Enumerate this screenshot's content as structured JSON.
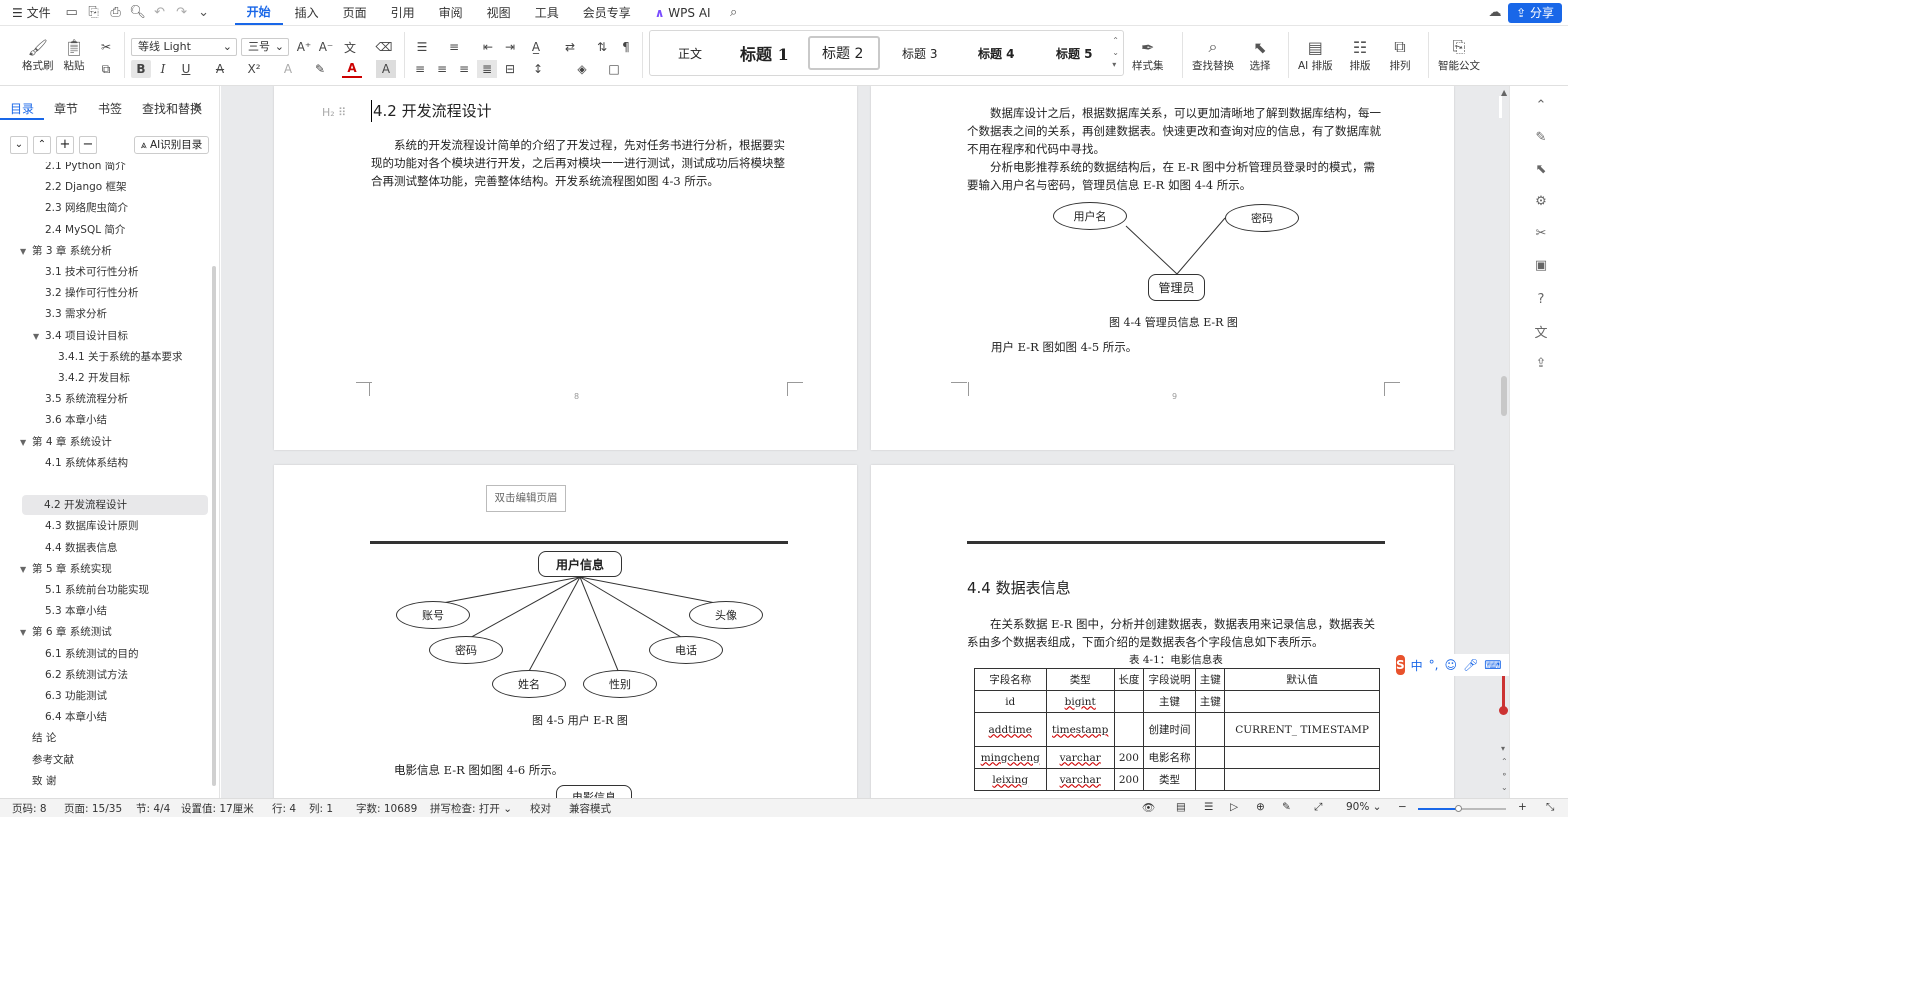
{
  "topbar": {
    "file": "文件",
    "tabs": [
      "开始",
      "插入",
      "页面",
      "引用",
      "审阅",
      "视图",
      "工具",
      "会员专享"
    ],
    "wps_ai": "WPS AI",
    "share": "分享"
  },
  "ribbon": {
    "format_painter": "格式刷",
    "paste": "粘贴",
    "font_name": "等线 Light",
    "font_size": "三号",
    "styles": [
      "正文",
      "标题 1",
      "标题 2",
      "标题 3",
      "标题 4",
      "标题 5"
    ],
    "style_set": "样式集",
    "find_replace": "查找替换",
    "select": "选择",
    "ai_layout": "AI 排版",
    "layout": "排版",
    "arrange": "排列",
    "smart_doc": "智能公文"
  },
  "left": {
    "tabs": [
      "目录",
      "章节",
      "书签",
      "查找和替换"
    ],
    "ai_toc": "AI识别目录",
    "toc": [
      {
        "label": "2.1  Python 简介",
        "level": 2
      },
      {
        "label": "2.2  Django 框架",
        "level": 2
      },
      {
        "label": "2.3 网络爬虫简介",
        "level": 2
      },
      {
        "label": "2.4 MySQL 简介",
        "level": 2
      },
      {
        "label": "第 3 章   系统分析",
        "level": 1
      },
      {
        "label": "3.1   技术可行性分析",
        "level": 2
      },
      {
        "label": "3.2   操作可行性分析",
        "level": 2
      },
      {
        "label": "3.3   需求分析",
        "level": 2
      },
      {
        "label": "3.4   项目设计目标",
        "level": 2
      },
      {
        "label": "3.4.1 关于系统的基本要求",
        "level": 3
      },
      {
        "label": "3.4.2 开发目标",
        "level": 3
      },
      {
        "label": "3.5   系统流程分析",
        "level": 2
      },
      {
        "label": "3.6   本章小结",
        "level": 2
      },
      {
        "label": "第 4 章   系统设计",
        "level": 1
      },
      {
        "label": "4.1   系统体系结构",
        "level": 2
      },
      {
        "label": "",
        "level": 2
      },
      {
        "label": "4.2   开发流程设计",
        "level": 2
      },
      {
        "label": "4.3   数据库设计原则",
        "level": 2
      },
      {
        "label": "4.4   数据表信息",
        "level": 2
      },
      {
        "label": "第 5 章   系统实现",
        "level": 1
      },
      {
        "label": "5.1 系统前台功能实现",
        "level": 2
      },
      {
        "label": "5.3   本章小结",
        "level": 2
      },
      {
        "label": "第 6 章   系统测试",
        "level": 1
      },
      {
        "label": "6.1   系统测试的目的",
        "level": 2
      },
      {
        "label": "6.2   系统测试方法",
        "level": 2
      },
      {
        "label": "6.3   功能测试",
        "level": 2
      },
      {
        "label": "6.4   本章小结",
        "level": 2
      },
      {
        "label": "结   论",
        "level": 1
      },
      {
        "label": "参考文献",
        "level": 1
      },
      {
        "label": "致   谢",
        "level": 1
      }
    ]
  },
  "page8": {
    "heading": "4.2   开发流程设计",
    "para": "系统的开发流程设计简单的介绍了开发过程，先对任务书进行分析，根据要实现的功能对各个模块进行开发，之后再对模块一一进行测试，测试成功后将模块整合再测试整体功能，完善整体结构。开发系统流程图如图 4-3 所示。",
    "pageno": "8"
  },
  "page9": {
    "para1": "数据库设计之后，根据数据库关系，可以更加清晰地了解到数据库结构，每一个数据表之间的关系，再创建数据表。快速更改和查询对应的信息，有了数据库就不用在程序和代码中寻找。",
    "para2": "分析电影推荐系统的数据结构后，在 E-R 图中分析管理员登录时的模式，需要输入用户名与密码，管理员信息 E-R 如图 4-4 所示。",
    "er_nodes": {
      "user": "用户名",
      "pwd": "密码",
      "admin": "管理员"
    },
    "caption": "图 4-4  管理员信息 E-R 图",
    "para3": "用户 E-R 图如图 4-5 所示。",
    "pageno": "9"
  },
  "page10": {
    "header_hint": "双击编辑页眉",
    "center": "用户信息",
    "nodes": [
      "账号",
      "密码",
      "姓名",
      "性别",
      "电话",
      "头像"
    ],
    "caption": "图 4-5 用户 E-R 图",
    "para": "电影信息 E-R 图如图 4-6 所示。",
    "partial_node": "电影信息"
  },
  "page11": {
    "heading": "4.4   数据表信息",
    "para": "在关系数据 E-R 图中，分析并创建数据表，数据表用来记录信息，数据表关系由多个数据表组成，下面介绍的是数据表各个字段信息如下表所示。",
    "table_caption": "表 4-1：电影信息表",
    "table": {
      "headers": [
        "字段名称",
        "类型",
        "长度",
        "字段说明",
        "主键",
        "默认值"
      ],
      "rows": [
        [
          "id",
          "bigint",
          "",
          "主键",
          "主键",
          ""
        ],
        [
          "addtime",
          "timestamp",
          "",
          "创建时间",
          "",
          "CURRENT_ TIMESTAMP"
        ],
        [
          "mingcheng",
          "varchar",
          "200",
          "电影名称",
          "",
          ""
        ],
        [
          "leixing",
          "varchar",
          "200",
          "类型",
          "",
          ""
        ]
      ]
    }
  },
  "status": {
    "page_label": "页码: 8",
    "pages": "页面: 15/35",
    "section": "节: 4/4",
    "setting": "设置值: 17厘米",
    "row": "行: 4",
    "col": "列: 1",
    "words": "字数: 10689",
    "spell": "拼写检查: 打开",
    "proof": "校对",
    "compat": "兼容模式",
    "zoom": "90%"
  },
  "colors": {
    "accent": "#1967e8",
    "canvas": "#e9eaec"
  }
}
